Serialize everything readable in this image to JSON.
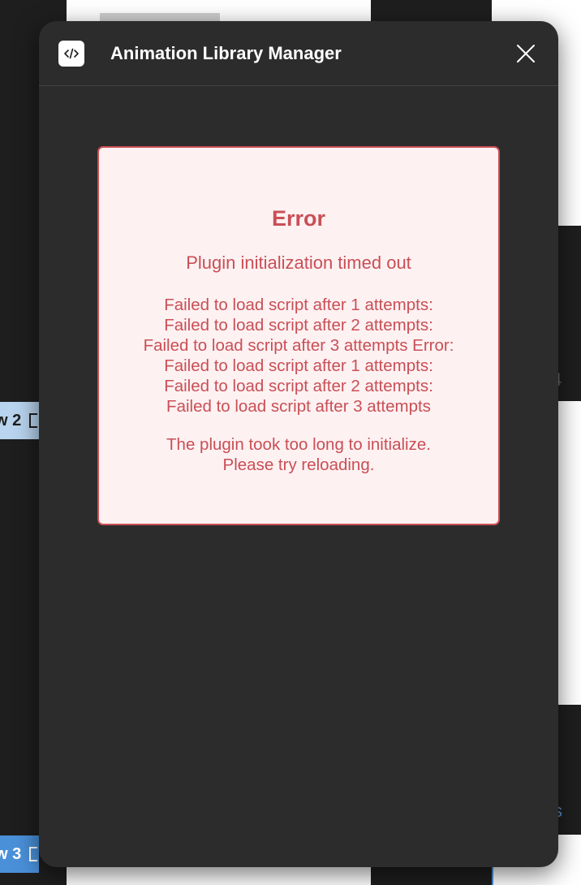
{
  "background": {
    "row_tabs": [
      {
        "label": "w 2"
      },
      {
        "label": "w 3"
      }
    ],
    "right_number": "4",
    "right_link": "s"
  },
  "dialog": {
    "title": "Animation Library Manager",
    "app_icon": "code-icon",
    "close_icon": "close-icon"
  },
  "error": {
    "heading": "Error",
    "subtitle": "Plugin initialization timed out",
    "details": [
      "Failed to load script after 1 attempts:",
      "Failed to load script after 2 attempts:",
      "Failed to load script after 3 attempts Error:",
      "Failed to load script after 1 attempts:",
      "Failed to load script after 2 attempts:",
      "Failed to load script after 3 attempts"
    ],
    "hint": [
      "The plugin took too long to initialize.",
      "Please try reloading."
    ]
  },
  "colors": {
    "dialog_bg": "#2c2c2c",
    "error_text": "#c94f55",
    "error_bg": "#fdf1f2",
    "accent_blue": "#4a90d9"
  }
}
